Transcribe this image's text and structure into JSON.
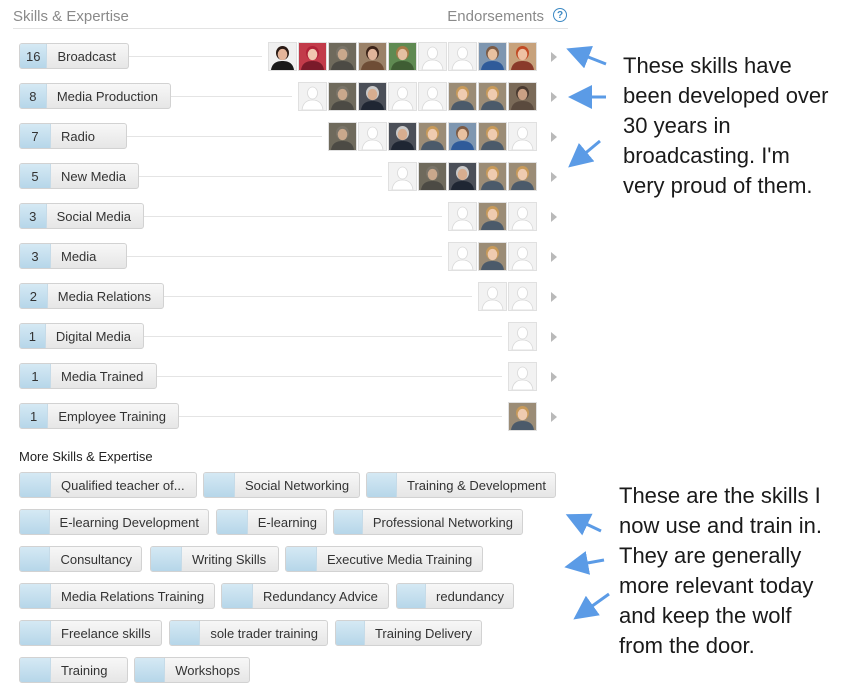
{
  "header": {
    "title": "Skills & Expertise",
    "endorsements_label": "Endorsements",
    "help_glyph": "?"
  },
  "colors": {
    "accent": "#3b88c3",
    "count_bg": "#c6e0ef",
    "arrow": "#5b9be6"
  },
  "skills": [
    {
      "count": "16",
      "name": "Broadcast",
      "avatars": [
        "p1",
        "p2",
        "p3",
        "p4",
        "p5",
        "gen",
        "gen",
        "p6",
        "p7"
      ]
    },
    {
      "count": "8",
      "name": "Media Production",
      "avatars": [
        "gen",
        "p3",
        "p8",
        "gen",
        "gen",
        "p9",
        "p9",
        "p10"
      ]
    },
    {
      "count": "7",
      "name": "Radio",
      "avatars": [
        "p3",
        "gen",
        "p8",
        "p9",
        "p6",
        "p9",
        "gen"
      ]
    },
    {
      "count": "5",
      "name": "New Media",
      "avatars": [
        "gen",
        "p3",
        "p8",
        "p9",
        "p9"
      ]
    },
    {
      "count": "3",
      "name": "Social Media",
      "avatars": [
        "gen",
        "p9",
        "gen"
      ]
    },
    {
      "count": "3",
      "name": "Media",
      "avatars": [
        "gen",
        "p9",
        "gen"
      ]
    },
    {
      "count": "2",
      "name": "Media Relations",
      "avatars": [
        "gen",
        "gen"
      ]
    },
    {
      "count": "1",
      "name": "Digital Media",
      "avatars": [
        "gen"
      ]
    },
    {
      "count": "1",
      "name": "Media Trained",
      "avatars": [
        "gen"
      ]
    },
    {
      "count": "1",
      "name": "Employee Training",
      "avatars": [
        "p9"
      ]
    }
  ],
  "more": {
    "title": "More Skills & Expertise",
    "tags": [
      "Qualified teacher of...",
      "Social Networking",
      "Training & Development",
      "E-learning Development",
      "E-learning",
      "Professional Networking",
      "Consultancy",
      "Writing Skills",
      "Executive Media Training",
      "Media Relations Training",
      "Redundancy Advice",
      "redundancy",
      "Freelance skills",
      "sole trader training",
      "Training Delivery",
      "Training",
      "Workshops"
    ]
  },
  "notes": {
    "top": [
      "These skills have",
      "been developed over",
      "30 years in",
      "broadcasting. I'm",
      "very proud of them."
    ],
    "bottom": [
      "These are the skills I",
      "now use and train in.",
      "They are generally",
      "more relevant today",
      "and keep the wolf",
      "from the door."
    ]
  }
}
